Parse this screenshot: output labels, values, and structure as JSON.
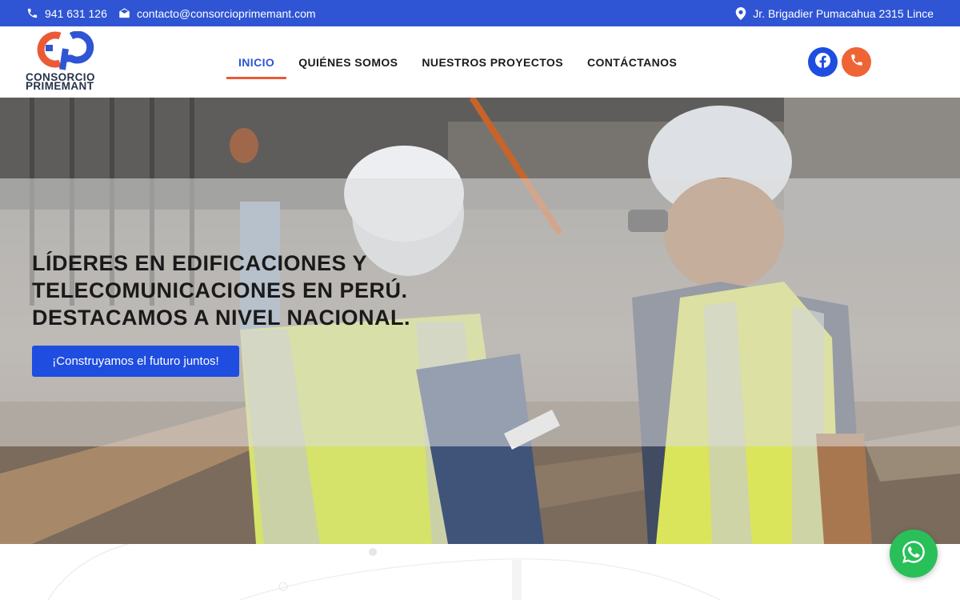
{
  "topbar": {
    "phone": "941 631 126",
    "email": "contacto@consorcioprimemant.com",
    "address": "Jr. Brigadier Pumacahua 2315 Lince",
    "icons": {
      "phone": "phone-icon",
      "email": "envelope-icon",
      "address": "map-pin-icon"
    }
  },
  "logo": {
    "line1": "CONSORCIO",
    "line2": "PRIMEMANT"
  },
  "nav": {
    "items": [
      {
        "label": "INICIO",
        "active": true
      },
      {
        "label": "QUIÉNES SOMOS",
        "active": false
      },
      {
        "label": "NUESTROS PROYECTOS",
        "active": false
      },
      {
        "label": "CONTÁCTANOS",
        "active": false
      }
    ]
  },
  "social": {
    "icons": [
      "facebook-icon",
      "phone-icon"
    ]
  },
  "hero": {
    "title_lines": [
      "LÍDERES EN EDIFICACIONES Y",
      "TELECOMUNICACIONES EN PERÚ.",
      "DESTACAMOS A NIVEL NACIONAL."
    ],
    "cta_label": "¡Construyamos el futuro juntos!"
  },
  "colors": {
    "primary": "#2f55d4",
    "accent": "#ea5a36",
    "cta": "#1f4de0",
    "whatsapp": "#29c05a"
  },
  "floating": {
    "whatsapp_icon": "whatsapp-icon"
  }
}
